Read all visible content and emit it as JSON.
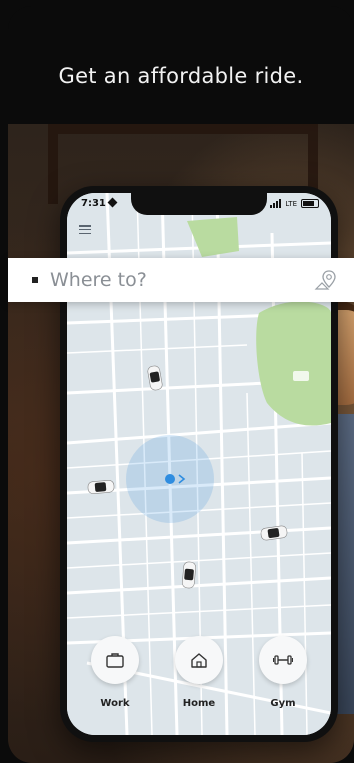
{
  "headline": "Get an affordable ride.",
  "statusbar": {
    "time": "7:31",
    "carrier": "LTE"
  },
  "search": {
    "placeholder": "Where to?"
  },
  "shortcuts": [
    {
      "label": "Work",
      "icon": "briefcase-icon"
    },
    {
      "label": "Home",
      "icon": "home-icon"
    },
    {
      "label": "Gym",
      "icon": "dumbbell-icon"
    }
  ],
  "colors": {
    "map_background": "#dde5ea",
    "park": "#b9dba0",
    "location_dot": "#2f8de0",
    "search_placeholder": "#8a8f95"
  }
}
